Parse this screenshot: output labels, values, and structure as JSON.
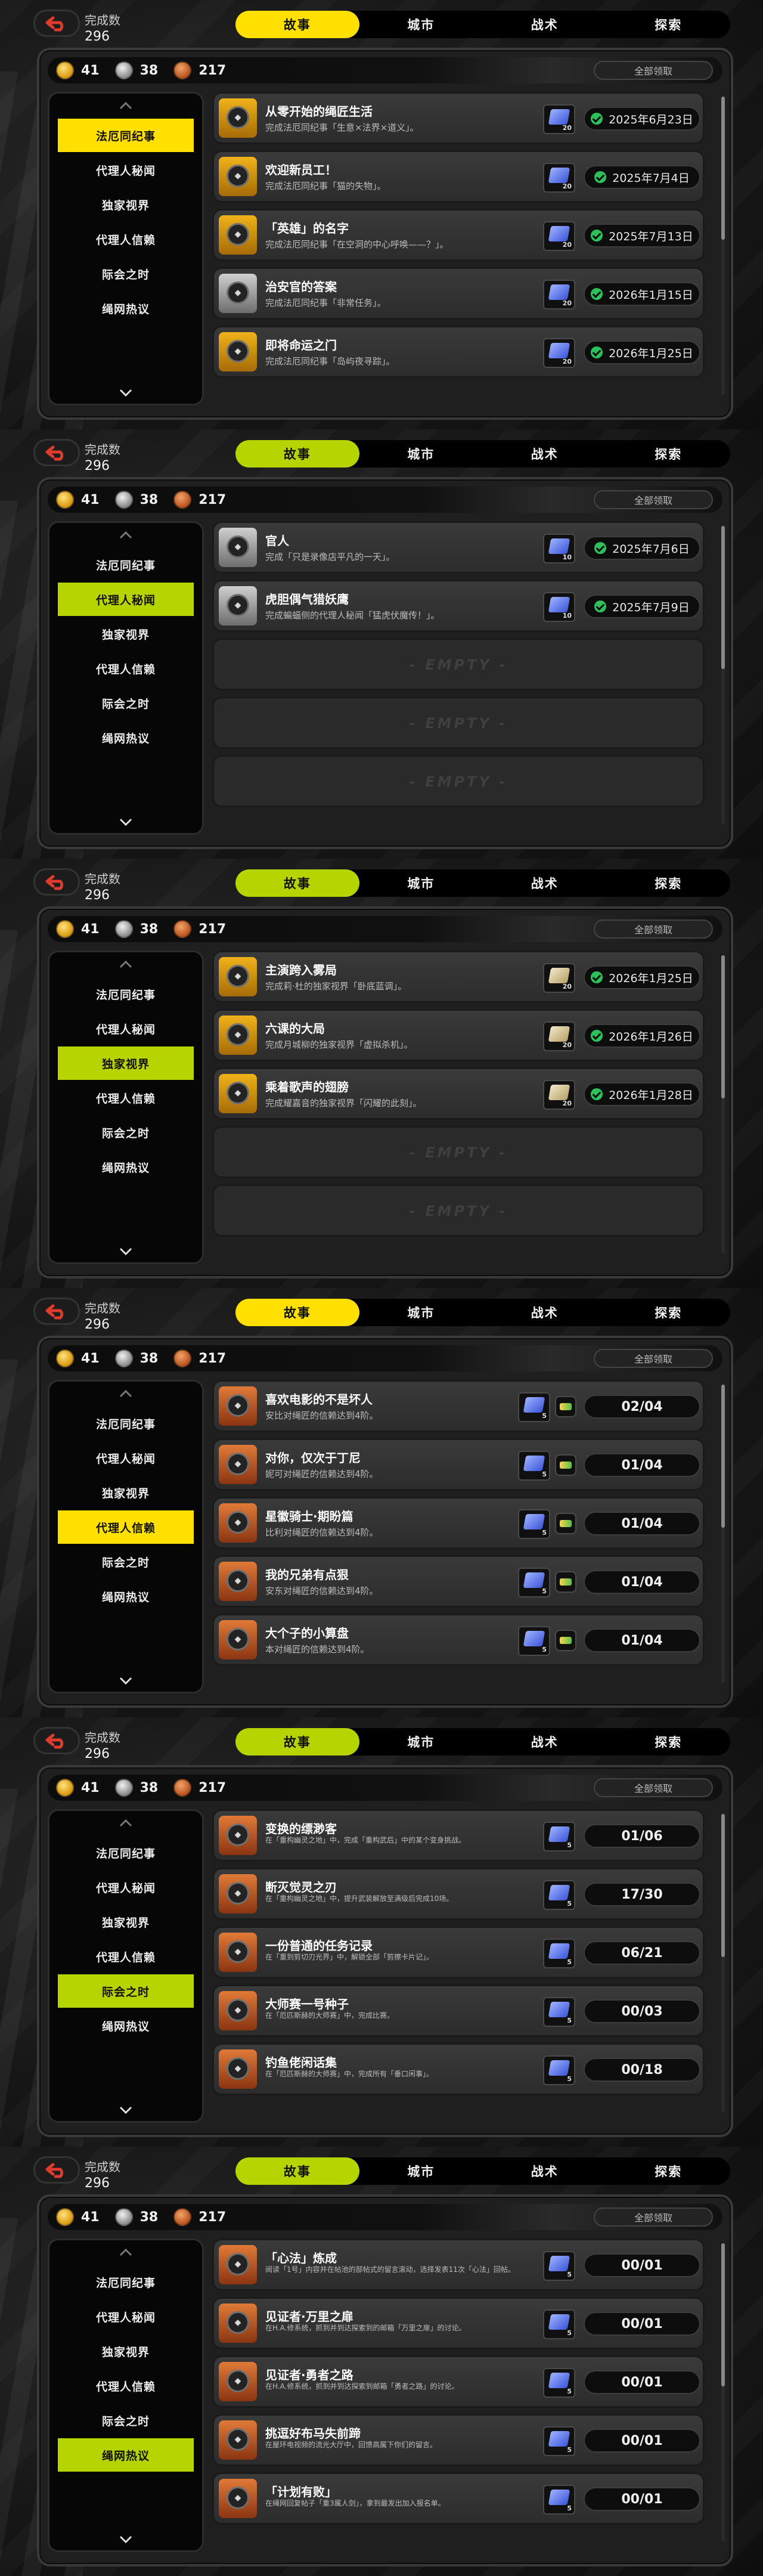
{
  "colors": {
    "yellow": "#ffe000",
    "lime": "#b6d400",
    "gold_medal": "#f0b21a",
    "silver_medal": "#bdbdbd",
    "copper_medal": "#d86a2c",
    "check_green": "#2ec05b"
  },
  "header": {
    "count_label": "完成数",
    "count_value": "296",
    "tabs": [
      "故事",
      "城市",
      "战术",
      "探索"
    ]
  },
  "currencies": {
    "gold": "41",
    "silver": "38",
    "bronze": "217"
  },
  "claim_all_label": "全部领取",
  "empty_label": "- EMPTY -",
  "sidebar_items": [
    "法厄同纪事",
    "代理人秘闻",
    "独家视界",
    "代理人信赖",
    "际会之时",
    "绳网热议"
  ],
  "panels": [
    {
      "active_tab": 0,
      "active_side": 0,
      "accent": "yellow",
      "tab_accent": "yellow",
      "show_claim": true,
      "rows": [
        {
          "medal": "gold",
          "title": "从零开始的绳匠生活",
          "desc": "完成法厄同纪事「生意×法界×道义」。",
          "reward": "film",
          "reward_num": "20",
          "date": "2025年6月23日"
        },
        {
          "medal": "gold",
          "title": "欢迎新员工！",
          "desc": "完成法厄同纪事「猫的失物」。",
          "reward": "film",
          "reward_num": "20",
          "date": "2025年7月4日"
        },
        {
          "medal": "gold",
          "title": "「英雄」的名字",
          "desc": "完成法厄同纪事「在空洞的中心呼唤——？」。",
          "reward": "film",
          "reward_num": "20",
          "date": "2025年7月13日"
        },
        {
          "medal": "silver",
          "title": "治安官的答案",
          "desc": "完成法厄同纪事「非常任务」。",
          "reward": "film",
          "reward_num": "20",
          "date": "2026年1月15日"
        },
        {
          "medal": "gold",
          "title": "即将命运之门",
          "desc": "完成法厄同纪事「岛屿夜寻踪」。",
          "reward": "film",
          "reward_num": "20",
          "date": "2026年1月25日"
        }
      ]
    },
    {
      "active_tab": 0,
      "active_side": 1,
      "accent": "lime",
      "tab_accent": "lime",
      "show_claim": true,
      "rows": [
        {
          "medal": "silver",
          "title": "官人",
          "desc": "完成「只是录像店平凡的一天」。",
          "reward": "film",
          "reward_num": "10",
          "date": "2025年7月6日"
        },
        {
          "medal": "silver",
          "title": "虎胆偶气猎妖鹰",
          "desc": "完成蝙蝠侧的代理人秘闻「猛虎伏魔传！」。",
          "reward": "film",
          "reward_num": "10",
          "date": "2025年7月9日"
        },
        {
          "empty": true
        },
        {
          "empty": true
        },
        {
          "empty": true
        }
      ]
    },
    {
      "active_tab": 0,
      "active_side": 2,
      "accent": "lime",
      "tab_accent": "lime",
      "show_claim": true,
      "rows": [
        {
          "medal": "gold",
          "title": "主演跨入雾局",
          "desc": "完成莉·杜的独家视界「卧底蓝调」。",
          "reward": "paper",
          "reward_num": "20",
          "date": "2026年1月25日"
        },
        {
          "medal": "gold",
          "title": "六课的大局",
          "desc": "完成月城柳的独家视界「虚拟杀机」。",
          "reward": "paper",
          "reward_num": "20",
          "date": "2026年1月26日"
        },
        {
          "medal": "gold",
          "title": "乘着歌声的翅膀",
          "desc": "完成耀嘉音的独家视界「闪耀的此刻」。",
          "reward": "paper",
          "reward_num": "20",
          "date": "2026年1月28日"
        },
        {
          "empty": true
        },
        {
          "empty": true
        }
      ]
    },
    {
      "active_tab": 0,
      "active_side": 3,
      "accent": "yellow",
      "tab_accent": "yellow",
      "show_claim": true,
      "rows": [
        {
          "medal": "copper",
          "title": "喜欢电影的不是坏人",
          "desc": "安比对绳匠的信赖达到4阶。",
          "double": true,
          "reward_num": "5",
          "progress": "02/04"
        },
        {
          "medal": "copper",
          "title": "对你，仅次于丁尼",
          "desc": "妮可对绳匠的信赖达到4阶。",
          "double": true,
          "reward_num": "5",
          "progress": "01/04"
        },
        {
          "medal": "copper",
          "title": "星徽骑士·期盼篇",
          "desc": "比利对绳匠的信赖达到4阶。",
          "double": true,
          "reward_num": "5",
          "progress": "01/04"
        },
        {
          "medal": "copper",
          "title": "我的兄弟有点狠",
          "desc": "安东对绳匠的信赖达到4阶。",
          "double": true,
          "reward_num": "5",
          "progress": "01/04"
        },
        {
          "medal": "copper",
          "title": "大个子的小算盘",
          "desc": "本对绳匠的信赖达到4阶。",
          "double": true,
          "reward_num": "5",
          "progress": "01/04"
        }
      ]
    },
    {
      "active_tab": 0,
      "active_side": 4,
      "accent": "lime",
      "tab_accent": "lime",
      "show_claim": true,
      "rows": [
        {
          "medal": "copper",
          "title": "变换的缥渺客",
          "desc": "在「重构幽灵之地」中，完成「重构武后」中的某个变身挑战。",
          "two_line": true,
          "reward": "film",
          "reward_num": "5",
          "progress": "01/06"
        },
        {
          "medal": "copper",
          "title": "断灭觉灵之刃",
          "desc": "在「重构幽灵之地」中，提升武装解放至满级后完成10场。",
          "two_line": true,
          "reward": "film",
          "reward_num": "5",
          "progress": "17/30"
        },
        {
          "medal": "copper",
          "title": "一份普通的任务记录",
          "desc": "在「重到剪切刃光界」中，解锁全部「剪擦卡片记」。",
          "two_line": true,
          "reward": "film",
          "reward_num": "5",
          "progress": "06/21"
        },
        {
          "medal": "copper",
          "title": "大师赛一号种子",
          "desc": "在「厄匹斯赫的大师赛」中，完成比赛。",
          "two_line": true,
          "reward": "film",
          "reward_num": "5",
          "progress": "00/03"
        },
        {
          "medal": "copper",
          "title": "钓鱼佬闲话集",
          "desc": "在「厄匹斯赫的大师赛」中，完成所有「垂口闲事」。",
          "two_line": true,
          "reward": "film",
          "reward_num": "5",
          "progress": "00/18"
        }
      ]
    },
    {
      "active_tab": 0,
      "active_side": 5,
      "accent": "lime",
      "tab_accent": "lime",
      "show_claim": true,
      "rows": [
        {
          "medal": "copper",
          "title": "「心法」炼成",
          "desc": "阅读「1号」内容并在帖池的部帖式的留言滚动，选择发表11次「心法」回帖。",
          "two_line": true,
          "reward": "film",
          "reward_num": "5",
          "progress": "00/01"
        },
        {
          "medal": "copper",
          "title": "见证者·万里之扉",
          "desc": "在H.A.修系统，抓到并到达探索到的邮箱「万里之扉」的讨论。",
          "two_line": true,
          "reward": "film",
          "reward_num": "5",
          "progress": "00/01"
        },
        {
          "medal": "copper",
          "title": "见证者·勇者之路",
          "desc": "在H.A.修系统，抓到并到达探索到邮箱「勇者之路」的讨论。",
          "two_line": true,
          "reward": "film",
          "reward_num": "5",
          "progress": "00/01"
        },
        {
          "medal": "copper",
          "title": "挑逗好布马失前蹄",
          "desc": "在屋环电视频的流光大厅中，回馈高属下你们的留言。",
          "two_line": true,
          "reward": "film",
          "reward_num": "5",
          "progress": "00/01"
        },
        {
          "medal": "copper",
          "title": "「计划有败」",
          "desc": "在绳网回复帖子「重3属人剑」，拿到最发出加入报名单。",
          "two_line": true,
          "reward": "film",
          "reward_num": "5",
          "progress": "00/01"
        }
      ]
    }
  ]
}
